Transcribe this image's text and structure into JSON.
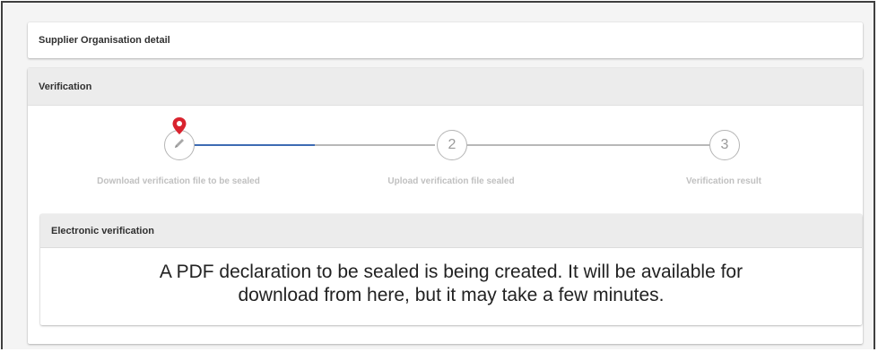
{
  "supplier": {
    "title": "Supplier Organisation detail"
  },
  "verification": {
    "title": "Verification",
    "steps": [
      {
        "number": "",
        "label": "Download verification file to be sealed",
        "icon": "pencil-icon",
        "state": "active"
      },
      {
        "number": "2",
        "label": "Upload verification file sealed",
        "state": "pending"
      },
      {
        "number": "3",
        "label": "Verification result",
        "state": "pending"
      }
    ],
    "marker_icon": "map-pin-icon"
  },
  "electronic": {
    "title": "Electronic verification",
    "message": "A PDF declaration to be sealed is being created. It will be available for\ndownload from here, but it may take a few minutes."
  },
  "colors": {
    "active_line": "#3d6bb3",
    "inactive_line": "#b8b8b8",
    "marker": "#d9232e",
    "header_bg": "#ececec"
  }
}
